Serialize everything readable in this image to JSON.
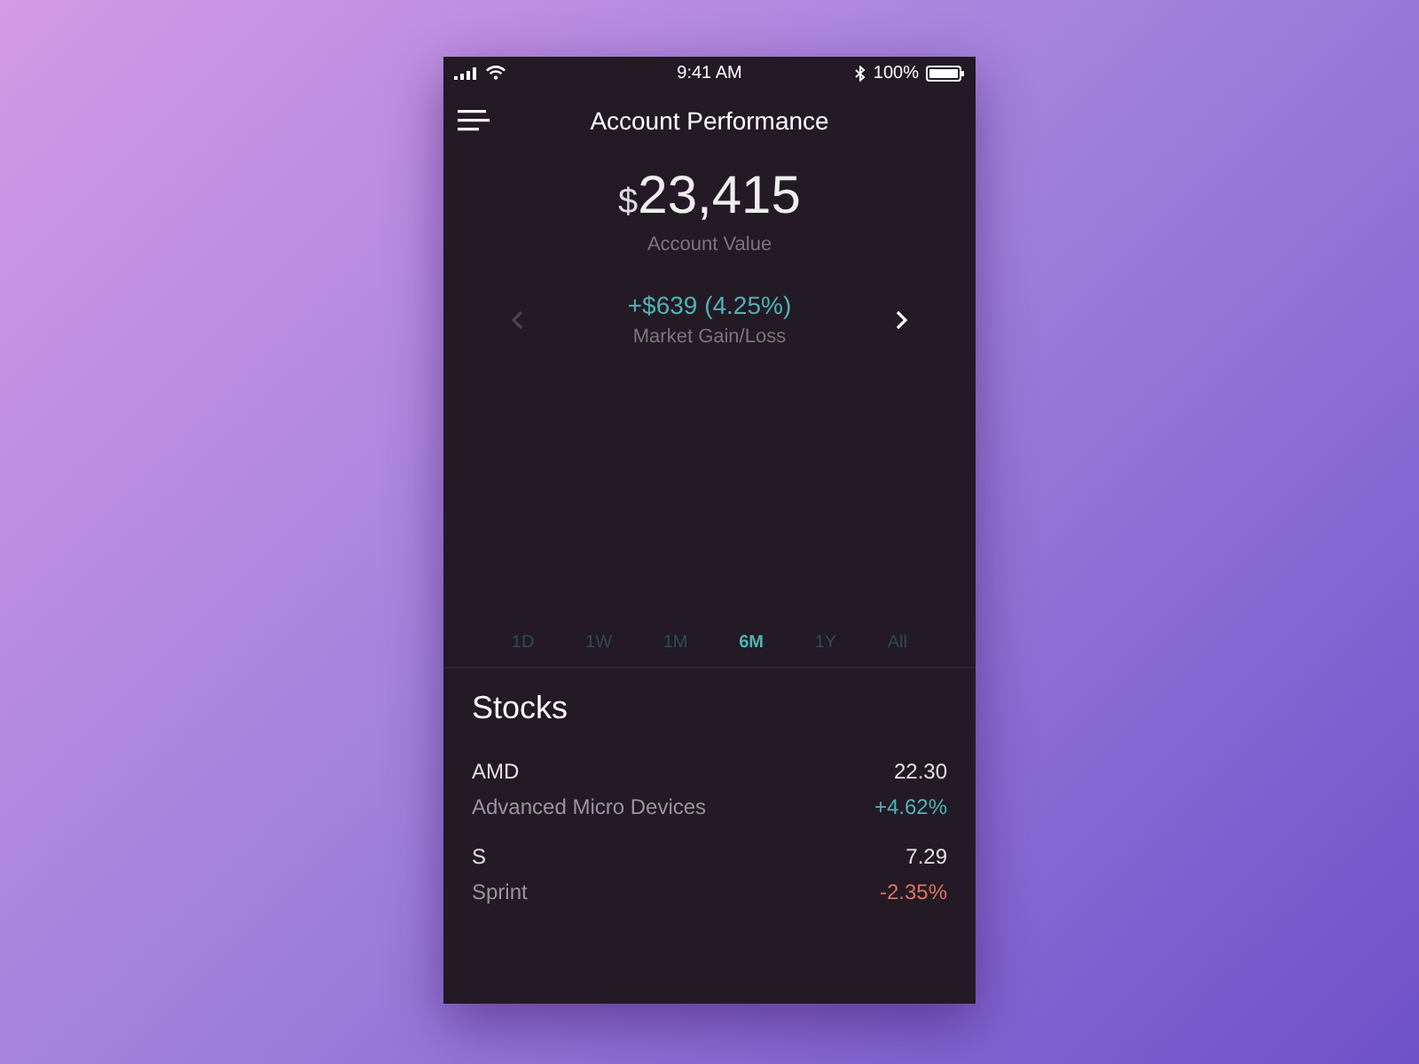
{
  "status_bar": {
    "time": "9:41 AM",
    "battery": "100%"
  },
  "header": {
    "title": "Account Performance"
  },
  "account": {
    "currency": "$",
    "value": "23,415",
    "label": "Account Value"
  },
  "gain": {
    "value": "+$639 (4.25%)",
    "label": "Market Gain/Loss",
    "prev_disabled": true,
    "next_disabled": false
  },
  "ranges": [
    {
      "label": "1D",
      "selected": false
    },
    {
      "label": "1W",
      "selected": false
    },
    {
      "label": "1M",
      "selected": false
    },
    {
      "label": "6M",
      "selected": true
    },
    {
      "label": "1Y",
      "selected": false
    },
    {
      "label": "All",
      "selected": false
    }
  ],
  "stocks": {
    "title": "Stocks",
    "items": [
      {
        "symbol": "AMD",
        "name": "Advanced Micro Devices",
        "price": "22.30",
        "change": "+4.62%",
        "color": "#4fb3b6"
      },
      {
        "symbol": "S",
        "name": "Sprint",
        "price": "7.29",
        "change": "-2.35%",
        "color": "#e0735c"
      }
    ]
  }
}
